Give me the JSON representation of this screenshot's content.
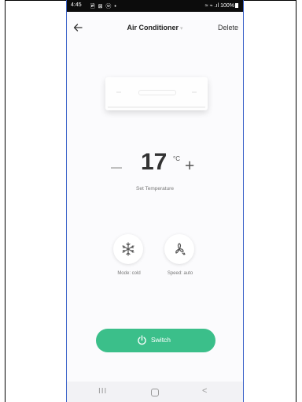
{
  "status_bar": {
    "time": "4:45",
    "left_icons": "🖻 ⊠ ⓦ •",
    "right_text": "≈ ⌁ .ıl 100%"
  },
  "header": {
    "title": "Air Conditioner",
    "chevron": "▾",
    "delete_label": "Delete"
  },
  "temperature": {
    "value": "17",
    "unit": "°C",
    "minus_label": "−",
    "plus_label": "+",
    "caption": "Set Temperature"
  },
  "controls": {
    "mode_label": "Mode: cold",
    "speed_label": "Speed: auto"
  },
  "switch_button": {
    "label": "Switch"
  },
  "nav": {
    "recents": "III",
    "back": "<"
  },
  "colors": {
    "accent": "#3bbf8a",
    "status_bar": "#0c0c0c"
  }
}
